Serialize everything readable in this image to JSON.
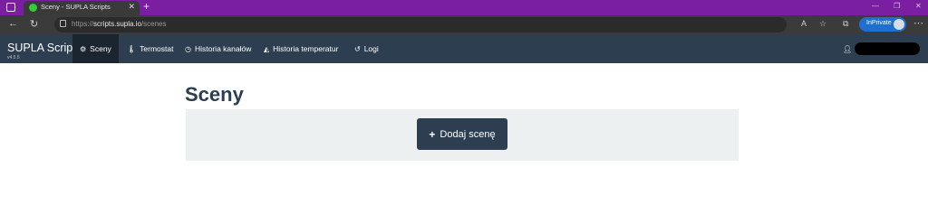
{
  "browser": {
    "tab_title": "Sceny - SUPLA Scripts",
    "url_prefix": "https://",
    "url_host": "scripts.supla.io",
    "url_path": "/scenes",
    "inprivate_label": "InPrivate"
  },
  "app": {
    "brand": "SUPLA Scripts",
    "version": "v4.5.5",
    "nav": [
      {
        "label": "Sceny",
        "icon": "cogs-icon",
        "active": true
      },
      {
        "label": "Termostat",
        "icon": "thermometer-icon"
      },
      {
        "label": "Historia kanałów",
        "icon": "clock-icon"
      },
      {
        "label": "Historia temperatur",
        "icon": "area-chart-icon"
      },
      {
        "label": "Logi",
        "icon": "history-icon"
      }
    ],
    "user_icon": "user-icon"
  },
  "main": {
    "title": "Sceny",
    "add_button_label": "Dodaj scenę"
  },
  "colors": {
    "navbar": "#2c3e50",
    "navbar_active": "#1a252f",
    "panel": "#ecf0f1",
    "browser_frame": "#7a1fa2",
    "inprivate": "#1e6fd0"
  }
}
